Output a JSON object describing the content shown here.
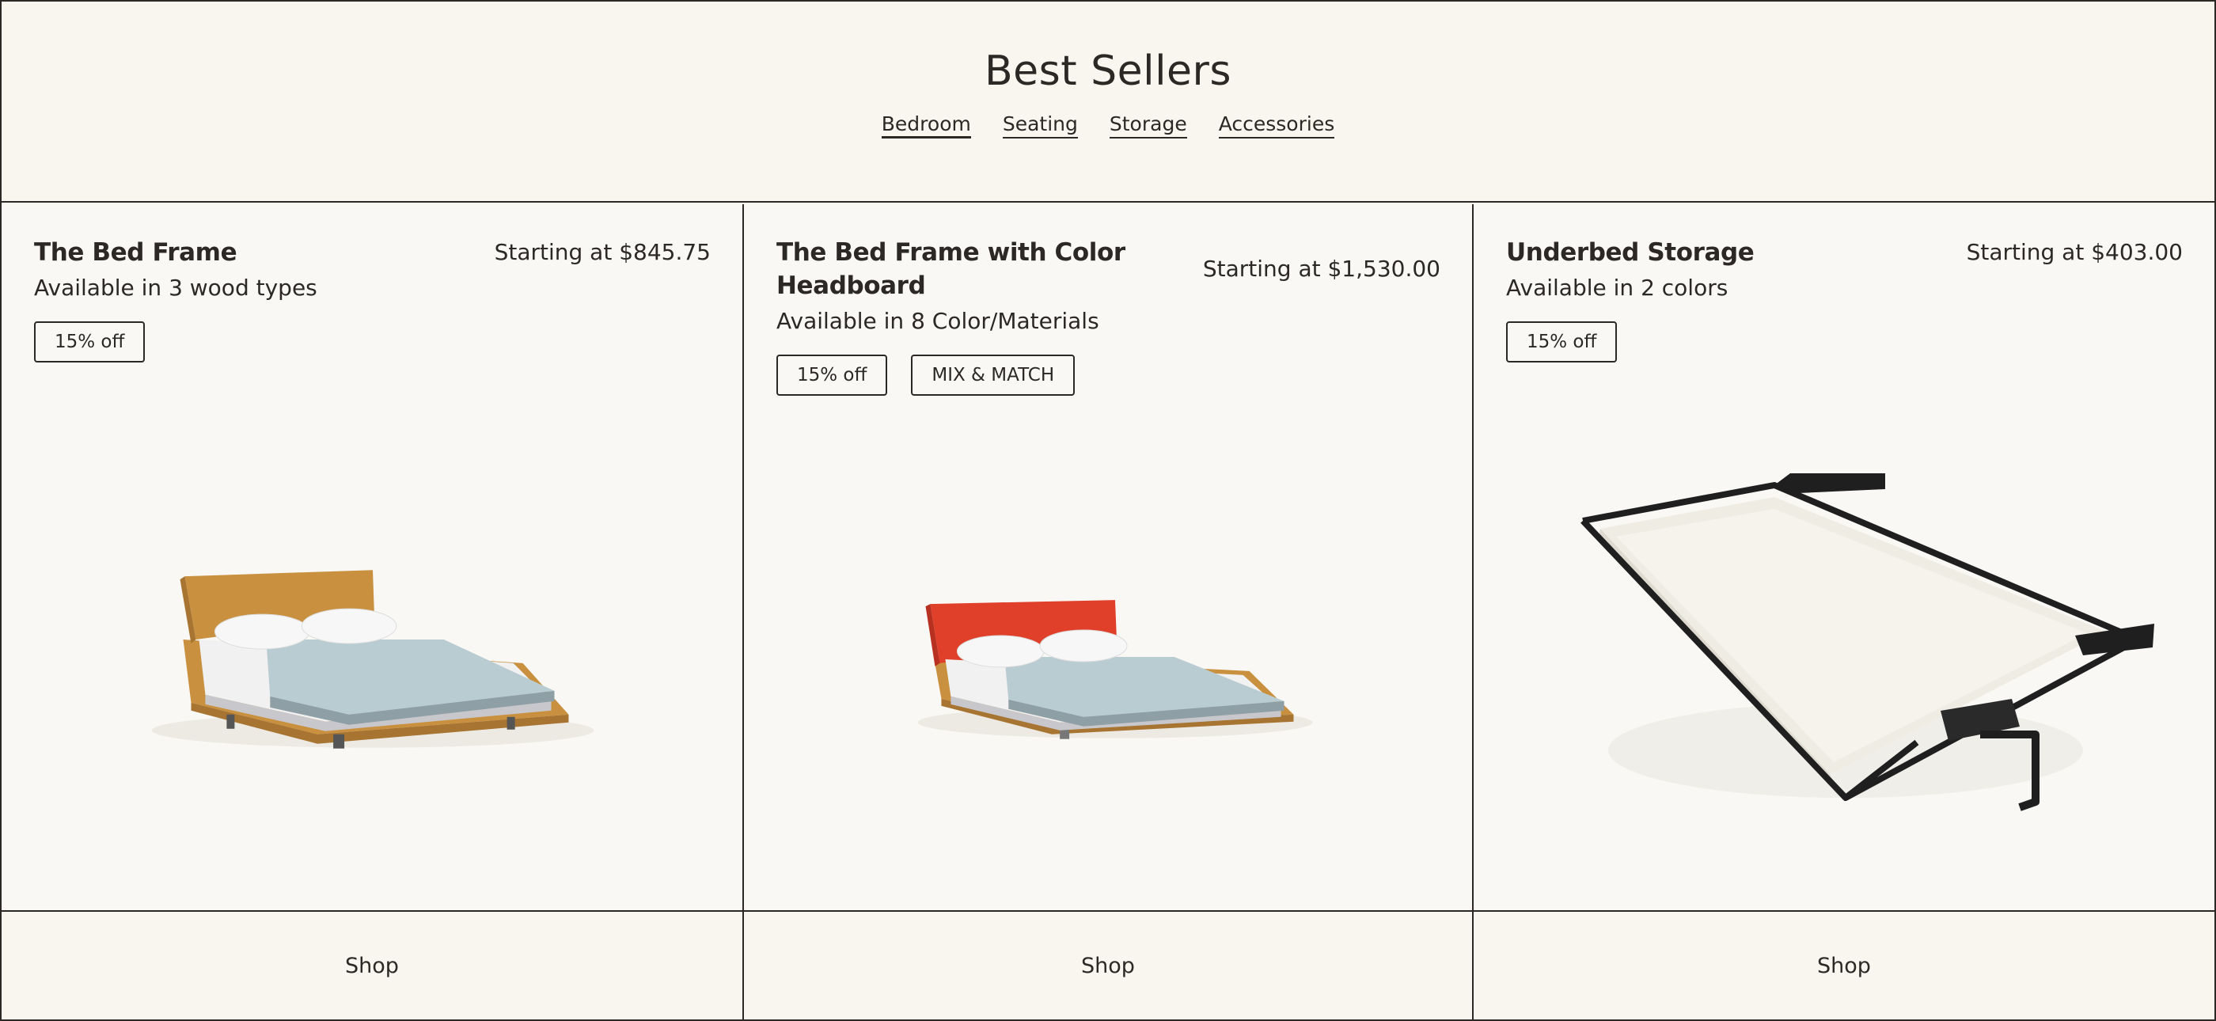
{
  "header": {
    "title": "Best Sellers",
    "tabs": [
      {
        "label": "Bedroom",
        "active": true
      },
      {
        "label": "Seating",
        "active": false
      },
      {
        "label": "Storage",
        "active": false
      },
      {
        "label": "Accessories",
        "active": false
      }
    ]
  },
  "products": [
    {
      "title": "The Bed Frame",
      "price": "Starting at $845.75",
      "subtitle": "Available in 3 wood types",
      "badges": [
        "15% off"
      ],
      "image": "bed-frame-wood-image",
      "shop_label": "Shop"
    },
    {
      "title": "The Bed Frame with Color Headboard",
      "price": "Starting at $1,530.00",
      "subtitle": "Available in 8 Color/Materials",
      "badges": [
        "15% off",
        "MIX & MATCH"
      ],
      "image": "bed-frame-red-headboard-image",
      "shop_label": "Shop"
    },
    {
      "title": "Underbed Storage",
      "price": "Starting at $403.00",
      "subtitle": "Available in 2 colors",
      "badges": [
        "15% off"
      ],
      "image": "underbed-storage-tray-image",
      "shop_label": "Shop"
    }
  ],
  "colors": {
    "background": "#f8f6ef",
    "card": "#f9f8f5",
    "ink": "#2b2825",
    "wood": "#c9913f",
    "headboard_red": "#e0402a",
    "bedding_blue": "#b9ccd1",
    "storage_frame": "#1f1f1f",
    "storage_tray": "#efece4"
  }
}
